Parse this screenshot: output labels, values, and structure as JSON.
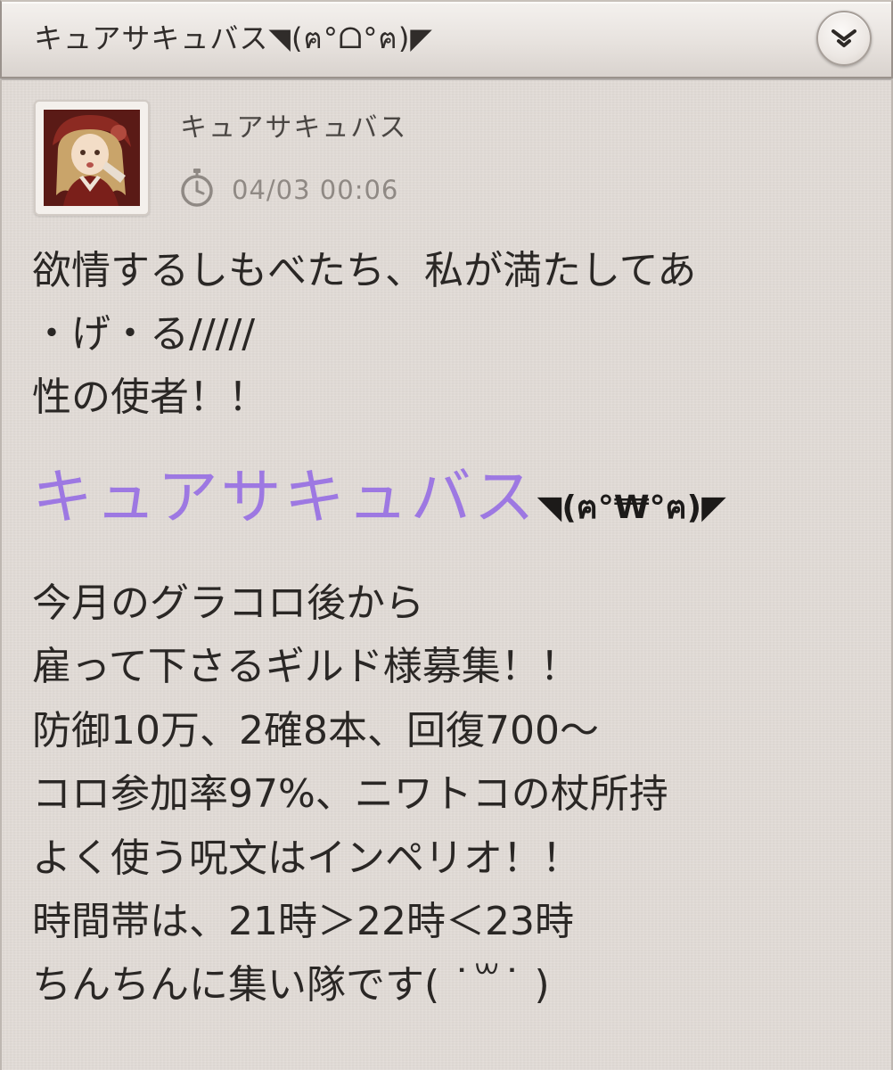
{
  "header": {
    "title": "キュアサキュバス◥(ฅ°ᗝ°ฅ)◤"
  },
  "post": {
    "author": "キュアサキュバス",
    "timestamp": "04/03 00:06",
    "lines_1": [
      "欲情するしもべたち、私が満たしてあ",
      "・げ・る/////",
      "性の使者！！"
    ],
    "highlight_name": "キュアサキュバス",
    "highlight_face": "◥(ฅ°₩°ฅ)◤",
    "highlight_color": "#9d78e2",
    "lines_2": [
      "今月のグラコロ後から",
      "雇って下さるギルド様募集！！",
      "防御10万、2確8本、回復700〜",
      "コロ参加率97%、ニワトコの杖所持",
      "よく使う呪文はインペリオ！！",
      "時間帯は、21時＞22時＜23時",
      "ちんちんに集い隊です( ˙꒳˙ )"
    ]
  },
  "icons": {
    "expand": "chevron-down-icon",
    "clock": "stopwatch-icon",
    "avatar": "avatar-image"
  }
}
